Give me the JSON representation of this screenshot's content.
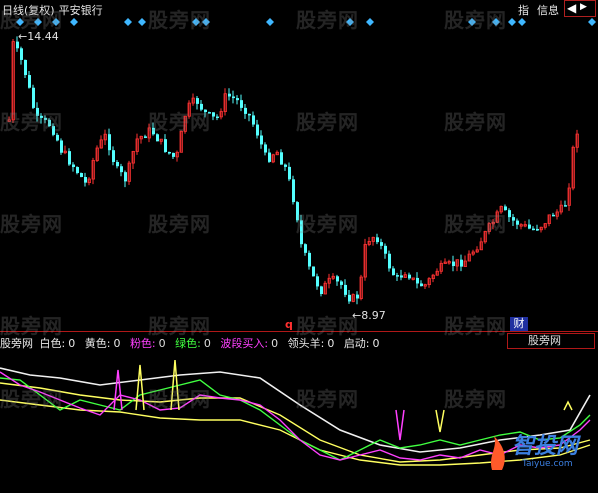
{
  "header": {
    "title": "日线(复权)",
    "stock": "平安银行",
    "zhi_label": "指",
    "xinxi_label": "信息",
    "nav_left": "◀",
    "nav_right": "▶"
  },
  "price_labels": {
    "high": "←14.44",
    "low": "←8.97",
    "q_mark": "q",
    "cai_badge": "财"
  },
  "watermark_text": "股旁网",
  "indicator": {
    "name": "股旁网",
    "items": [
      {
        "label": "白色:",
        "value": "0",
        "color": "#e8e8e8"
      },
      {
        "label": "黄色:",
        "value": "0",
        "color": "#e8e8e8"
      },
      {
        "label": "粉色:",
        "value": "0",
        "color": "#ff40ff"
      },
      {
        "label": "绿色:",
        "value": "0",
        "color": "#40ff40"
      },
      {
        "label": "波段买入:",
        "value": "0",
        "color": "#ff40ff"
      },
      {
        "label": "领头羊:",
        "value": "0",
        "color": "#e8e8e8"
      },
      {
        "label": "启动:",
        "value": "0",
        "color": "#e8e8e8"
      }
    ],
    "dropdown": "股旁网"
  },
  "logo": {
    "text": "智投网",
    "url": "Taiyue.com"
  },
  "colors": {
    "up_candle": "#ff3232",
    "down_candle": "#54ffff",
    "white_line": "#f0f0f0",
    "yellow_line": "#ffff60",
    "pink_line": "#ff40ff",
    "green_line": "#40ff40",
    "divider": "#b01818",
    "signal_diamond": "#3fb7ff"
  }
}
